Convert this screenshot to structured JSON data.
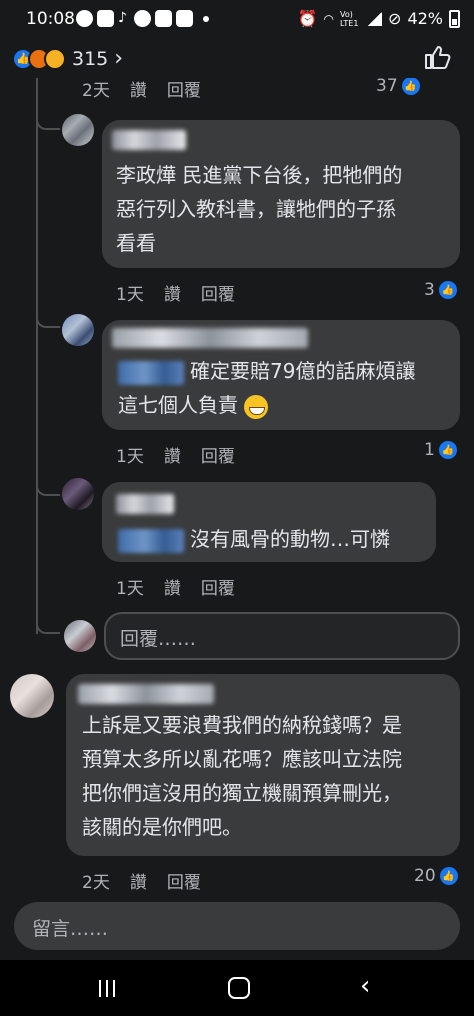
{
  "status_bar": {
    "time": "10:08",
    "network": "Vo) LTE1",
    "battery": "42%"
  },
  "header": {
    "reaction_count": "315",
    "reactions": [
      "like-icon",
      "angry-icon",
      "haha-icon"
    ]
  },
  "top_partial": {
    "meta": [
      "2天",
      "讚",
      "回覆"
    ],
    "likes": "37"
  },
  "comments": [
    {
      "text_lines": [
        "李政燁 民進黨下台後，把牠們的",
        "惡行列入教科書，讓牠們的子孫",
        "看看"
      ],
      "meta": [
        "1天",
        "讚",
        "回覆"
      ],
      "likes": "3"
    },
    {
      "text_lines": [
        "確定要賠79億的話麻煩讓",
        "這七個人負責"
      ],
      "meta": [
        "1天",
        "讚",
        "回覆"
      ],
      "likes": "1"
    },
    {
      "text_lines": [
        "沒有風骨的動物…可憐"
      ],
      "meta": [
        "1天",
        "讚",
        "回覆"
      ],
      "likes": ""
    }
  ],
  "reply_placeholder": "回覆……",
  "main_comment": {
    "text_lines": [
      "上訴是又要浪費我們的納稅錢嗎？是",
      "預算太多所以亂花嗎？應該叫立法院",
      "把你們這沒用的獨立機關預算刪光，",
      "該關的是你們吧。"
    ],
    "meta": [
      "2天",
      "讚",
      "回覆"
    ],
    "likes": "20"
  },
  "comment_placeholder": "留言……",
  "colors": {
    "background": "#18191a",
    "bubble": "#3a3b3c",
    "text": "#e4e6eb",
    "meta": "#b0b3b8",
    "like_blue": "#1877f2"
  }
}
